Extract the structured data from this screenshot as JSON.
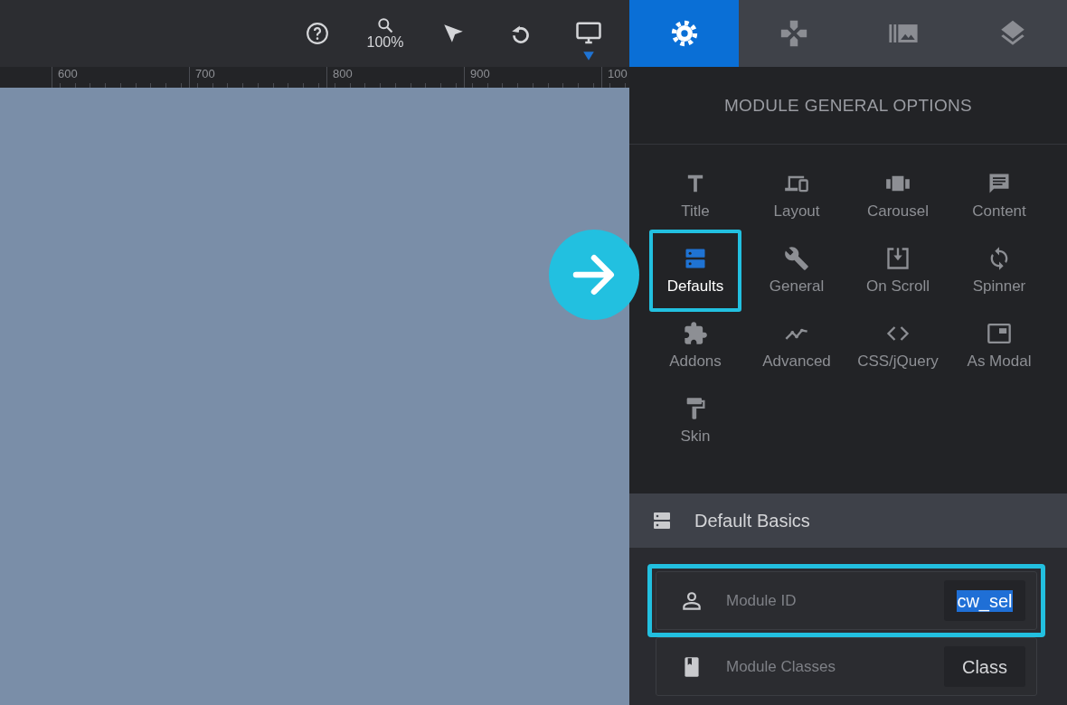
{
  "toolbar": {
    "zoom_level": "100%",
    "device_active": true
  },
  "ruler": {
    "labels": [
      "600",
      "700",
      "800",
      "900",
      "100"
    ]
  },
  "panel_tabs": [
    {
      "selected": true
    },
    {
      "selected": false
    },
    {
      "selected": false
    },
    {
      "selected": false
    }
  ],
  "panel": {
    "title": "MODULE GENERAL OPTIONS",
    "options": [
      {
        "label": "Title",
        "selected": false,
        "highlighted": false
      },
      {
        "label": "Layout",
        "selected": false,
        "highlighted": false
      },
      {
        "label": "Carousel",
        "selected": false,
        "highlighted": false
      },
      {
        "label": "Content",
        "selected": false,
        "highlighted": false
      },
      {
        "label": "Defaults",
        "selected": true,
        "highlighted": true
      },
      {
        "label": "General",
        "selected": false,
        "highlighted": false
      },
      {
        "label": "On Scroll",
        "selected": false,
        "highlighted": false
      },
      {
        "label": "Spinner",
        "selected": false,
        "highlighted": false
      },
      {
        "label": "Addons",
        "selected": false,
        "highlighted": false
      },
      {
        "label": "Advanced",
        "selected": false,
        "highlighted": false
      },
      {
        "label": "CSS/jQuery",
        "selected": false,
        "highlighted": false
      },
      {
        "label": "As Modal",
        "selected": false,
        "highlighted": false
      },
      {
        "label": "Skin",
        "selected": false,
        "highlighted": false
      }
    ],
    "section": {
      "title": "Default Basics",
      "fields": [
        {
          "label": "Module ID",
          "value": "cw_sel",
          "value_selected": true,
          "highlighted": true
        },
        {
          "label": "Module Classes",
          "value": "Class",
          "value_selected": false,
          "highlighted": false
        }
      ]
    }
  },
  "callout": {
    "visible": true
  }
}
